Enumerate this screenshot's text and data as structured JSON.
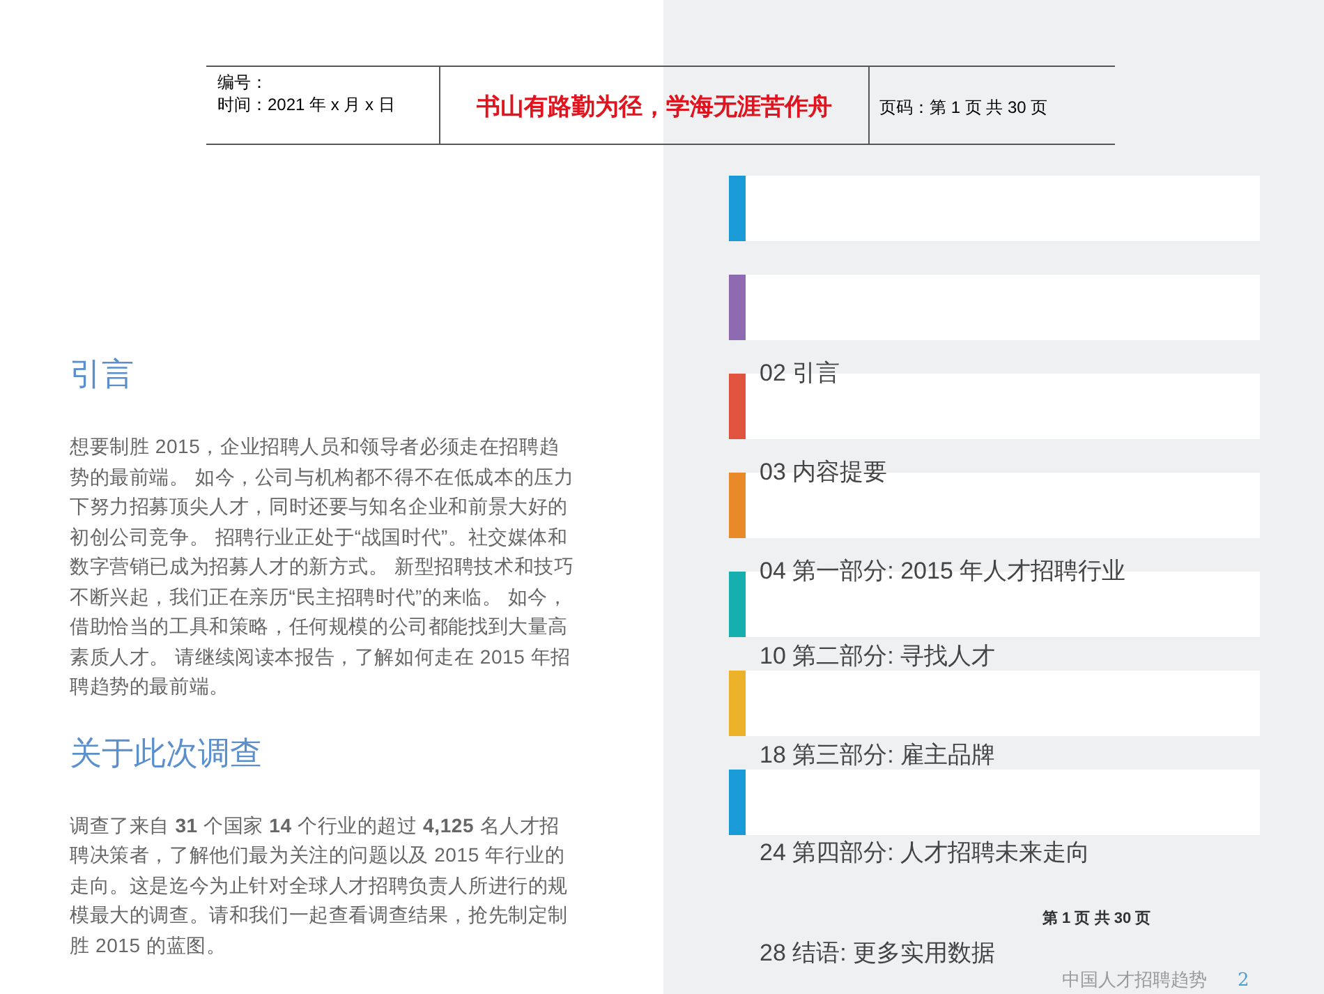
{
  "header": {
    "number_label": "编号：",
    "date": "时间：2021 年 x 月 x 日",
    "motto": "书山有路勤为径，学海无涯苦作舟",
    "page_info": "页码：第 1 页 共 30 页"
  },
  "sections": [
    {
      "heading": "引言",
      "body": "想要制胜 2015，企业招聘人员和领导者必须走在招聘趋势的最前端。 如今，公司与机构都不得不在低成本的压力下努力招募顶尖人才，同时还要与知名企业和前景大好的初创公司竞争。 招聘行业正处于“战国时代”。社交媒体和数字营销已成为招募人才的新方式。 新型招聘技术和技巧不断兴起，我们正在亲历“民主招聘时代”的来临。 如今，借助恰当的工具和策略，任何规模的公司都能找到大量高素质人才。 请继续阅读本报告，了解如何走在 2015 年招聘趋势的最前端。"
    },
    {
      "heading": "关于此次调查",
      "body": "调查了来自 **31** 个国家 **14** 个行业的超过 **4,125** 名人才招聘决策者，了解他们最为关注的问题以及 2015 年行业的走向。这是迄今为止针对全球人才招聘负责人所进行的规模最大的调查。请和我们一起查看调查结果，抢先制定制胜 2015 的蓝图。"
    }
  ],
  "color_cards": [
    {
      "color": "#1a9ad6"
    },
    {
      "color": "#8e6bb0"
    },
    {
      "color": "#e0533f"
    },
    {
      "color": "#e88a2a"
    },
    {
      "color": "#17aeb0"
    },
    {
      "color": "#ecb22a"
    },
    {
      "color": "#1a9ad6"
    }
  ],
  "toc": [
    {
      "page": "02",
      "title": "引言"
    },
    {
      "page": "03",
      "title": "内容提要"
    },
    {
      "page": "04",
      "title": "第一部分: 2015 年人才招聘行业"
    },
    {
      "page": "10",
      "title": "第二部分: 寻找人才"
    },
    {
      "page": "18",
      "title": "第三部分: 雇主品牌"
    },
    {
      "page": "24",
      "title": "第四部分: 人才招聘未来走向"
    },
    {
      "page": "28",
      "title": "结语: 更多实用数据"
    }
  ],
  "page_counter": "第 1 页 共 30 页",
  "footer": {
    "title": "中国人才招聘趋势",
    "page": "2"
  }
}
